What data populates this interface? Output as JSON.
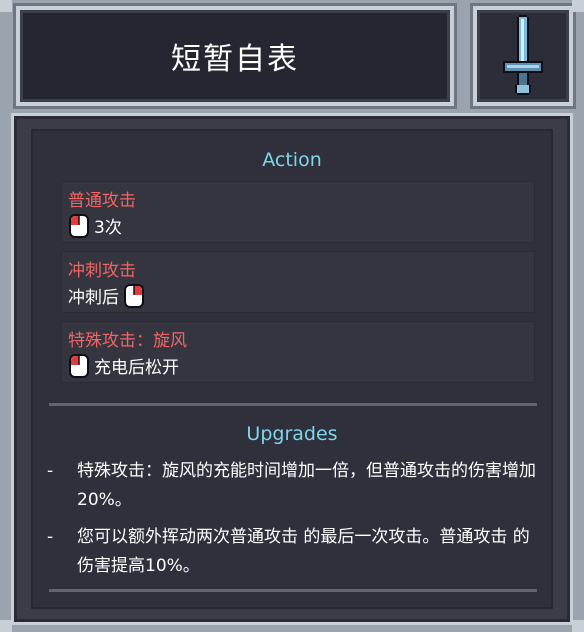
{
  "header": {
    "title": "短暂自表",
    "weapon_icon": "sword-icon"
  },
  "actions": {
    "heading": "Action",
    "items": [
      {
        "name": "普通攻击",
        "detail": "3次",
        "mouse_icon": "left-click-mouse-icon",
        "icon_position": "before"
      },
      {
        "name": "冲刺攻击",
        "detail": "冲刺后",
        "mouse_icon": "right-click-mouse-icon",
        "icon_position": "after"
      },
      {
        "name": "特殊攻击：旋风",
        "detail": "充电后松开",
        "mouse_icon": "left-click-mouse-icon",
        "icon_position": "before"
      }
    ]
  },
  "upgrades": {
    "heading": "Upgrades",
    "items": [
      {
        "bullet": "-",
        "text": "特殊攻击：旋风的充能时间增加一倍，但普通攻击的伤害增加20%。"
      },
      {
        "bullet": "-",
        "text": "您可以额外挥动两次普通攻击 的最后一次攻击。普通攻击 的伤害提高10%。"
      }
    ]
  },
  "colors": {
    "action_name": "#f06565",
    "section_heading": "#7fd6ea",
    "panel_bg": "#2f303b",
    "frame": "#9aa3ae"
  }
}
